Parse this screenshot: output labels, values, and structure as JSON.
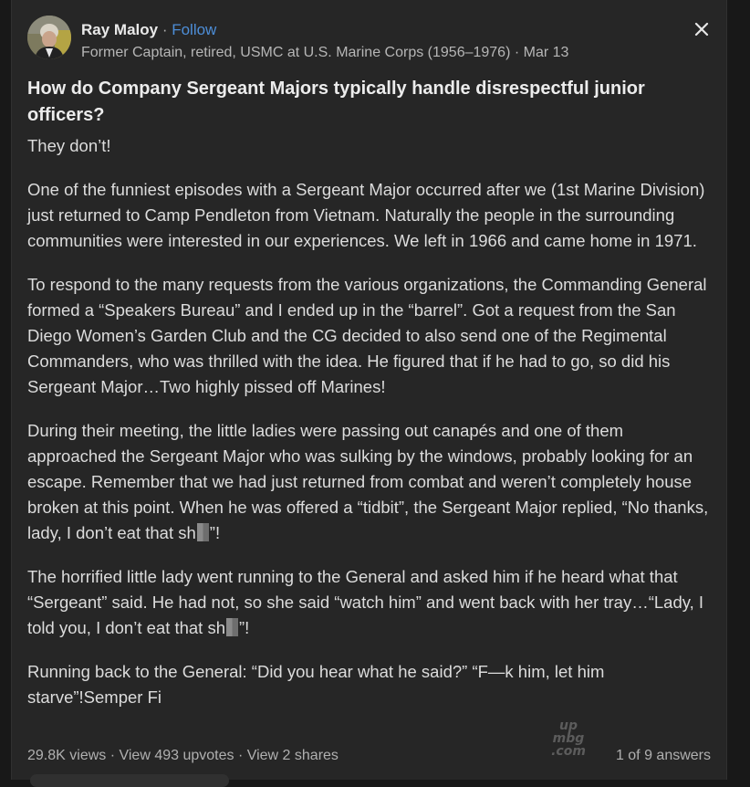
{
  "author": {
    "name": "Ray Maloy",
    "separator": " · ",
    "follow_label": "Follow",
    "credential": "Former Captain, retired, USMC at U.S. Marine Corps (1956–1976) · Mar 13"
  },
  "question": "How do Company Sergeant Majors typically handle disrespectful junior officers?",
  "answer": {
    "p1": "They don’t!",
    "p2": "One of the funniest episodes with a Sergeant Major occurred after we (1st Marine Division) just returned to Camp Pendleton from Vietnam. Naturally the people in the surrounding communities were interested in our experiences. We left in 1966 and came home in 1971.",
    "p3": "To respond to the many requests from the various organizations, the Commanding General formed a “Speakers Bureau” and I ended up in the “barrel”. Got a request from the San Diego Women’s Garden Club and the CG decided to also send one of the Regimental Commanders, who was thrilled with the idea. He figured that if he had to go, so did his Sergeant Major…Two highly pissed off Marines!",
    "p4_before": "During their meeting, the little ladies were passing out canapés and one of them approached the Sergeant Major who was sulking by the windows, probably looking for an escape. Remember that we had just returned from combat and weren’t completely house broken at this point. When he was offered a “tidbit”, the Sergeant Major replied, “No thanks, lady, I don’t eat that sh",
    "p4_after": "”!",
    "p5_before": "The horrified little lady went running to the General and asked him if he heard what that “Sergeant” said. He had not, so she said “watch him” and went back with her tray…“Lady, I told you, I don’t eat that sh",
    "p5_after": "”!",
    "p6": "Running back to the General: “Did you hear what he said?” “F—k him, let him starve”!Semper Fi"
  },
  "stats": {
    "views": "29.8K views",
    "sep": " · ",
    "upvotes": "View 493 upvotes",
    "shares": "View 2 shares"
  },
  "pager": "1 of 9 answers",
  "watermark": {
    "line1": "up",
    "line2": "mbg",
    "line3": ".com"
  },
  "colors": {
    "background": "#262626",
    "follow": "#4d8ed8",
    "text": "#dcdcdc"
  },
  "icons": {
    "close": "close-icon",
    "avatar": "avatar"
  }
}
